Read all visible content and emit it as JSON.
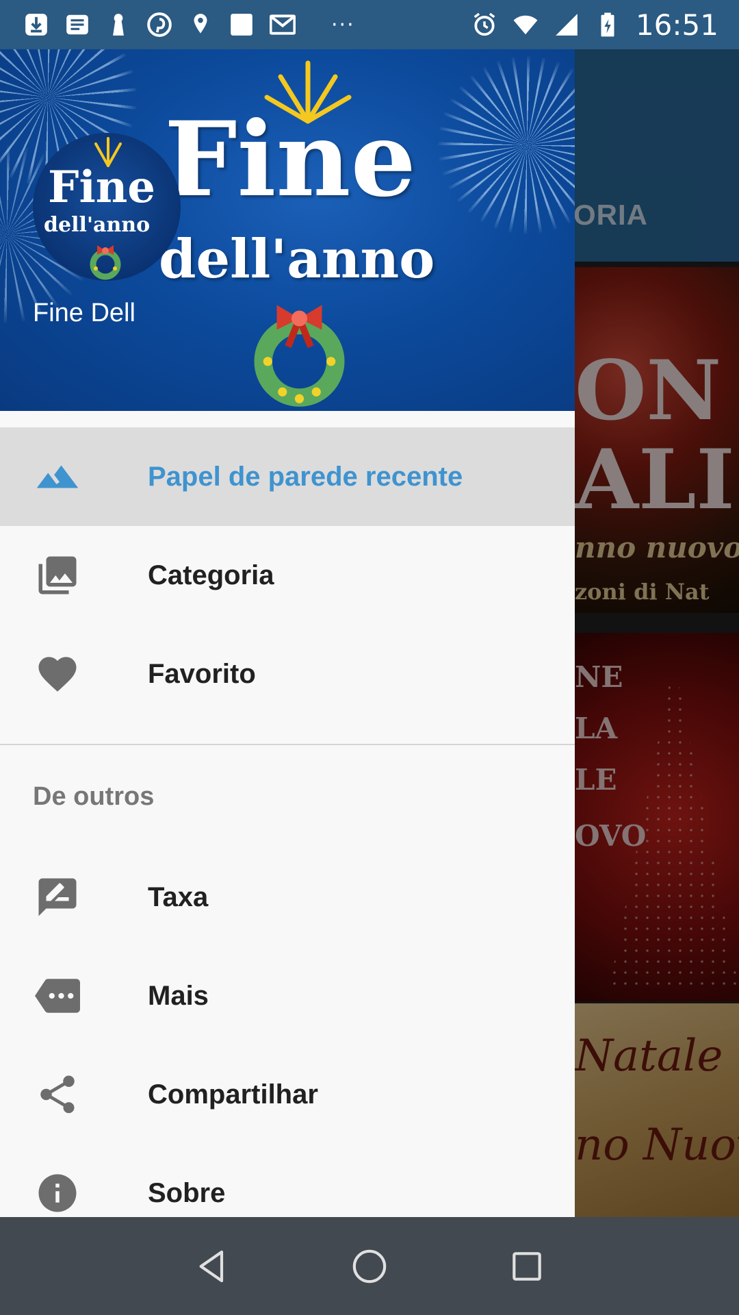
{
  "status_bar": {
    "time": "16:51",
    "left_icons": [
      "download-icon",
      "news-icon",
      "keyhole-icon",
      "pinterest-icon",
      "location-icon",
      "square-notification-icon",
      "gmail-icon"
    ],
    "overflow_dots": "···",
    "right_icons": [
      "alarm-icon",
      "wifi-icon",
      "signal-icon",
      "battery-charging-icon"
    ]
  },
  "background_app": {
    "tab_label": "ORIA",
    "card1_line1": "ON",
    "card1_line2": "ALI",
    "card1_line3": "nno nuovo",
    "card1_line4": "zoni di Nat",
    "card2_line1": "NE",
    "card2_line2": "LA",
    "card2_line3": "LE",
    "card2_line4": "OVO",
    "card3_line1": "Natale",
    "card3_line2": "no Nuovo"
  },
  "drawer": {
    "header": {
      "banner_title": "Fine",
      "banner_subtitle": "dell'anno",
      "logo_title": "Fine",
      "logo_subtitle": "dell'anno",
      "user_name": "Fine Dell"
    },
    "items": [
      {
        "label": "Papel de parede recente",
        "icon": "landscape-icon",
        "active": true
      },
      {
        "label": "Categoria",
        "icon": "photo-library-icon",
        "active": false
      },
      {
        "label": "Favorito",
        "icon": "heart-icon",
        "active": false
      }
    ],
    "section_header": "De outros",
    "other_items": [
      {
        "label": "Taxa",
        "icon": "rate-review-icon"
      },
      {
        "label": "Mais",
        "icon": "more-tag-icon"
      },
      {
        "label": "Compartilhar",
        "icon": "share-icon"
      },
      {
        "label": "Sobre",
        "icon": "info-icon"
      }
    ]
  },
  "colors": {
    "status_bar": "#2b5a82",
    "accent": "#3f93cf",
    "active_item_bg": "#dcdcdc",
    "drawer_bg": "#f8f8f8",
    "nav_bar": "#424950"
  },
  "nav_bar": {
    "buttons": [
      "back-icon",
      "home-icon",
      "recents-icon"
    ]
  }
}
